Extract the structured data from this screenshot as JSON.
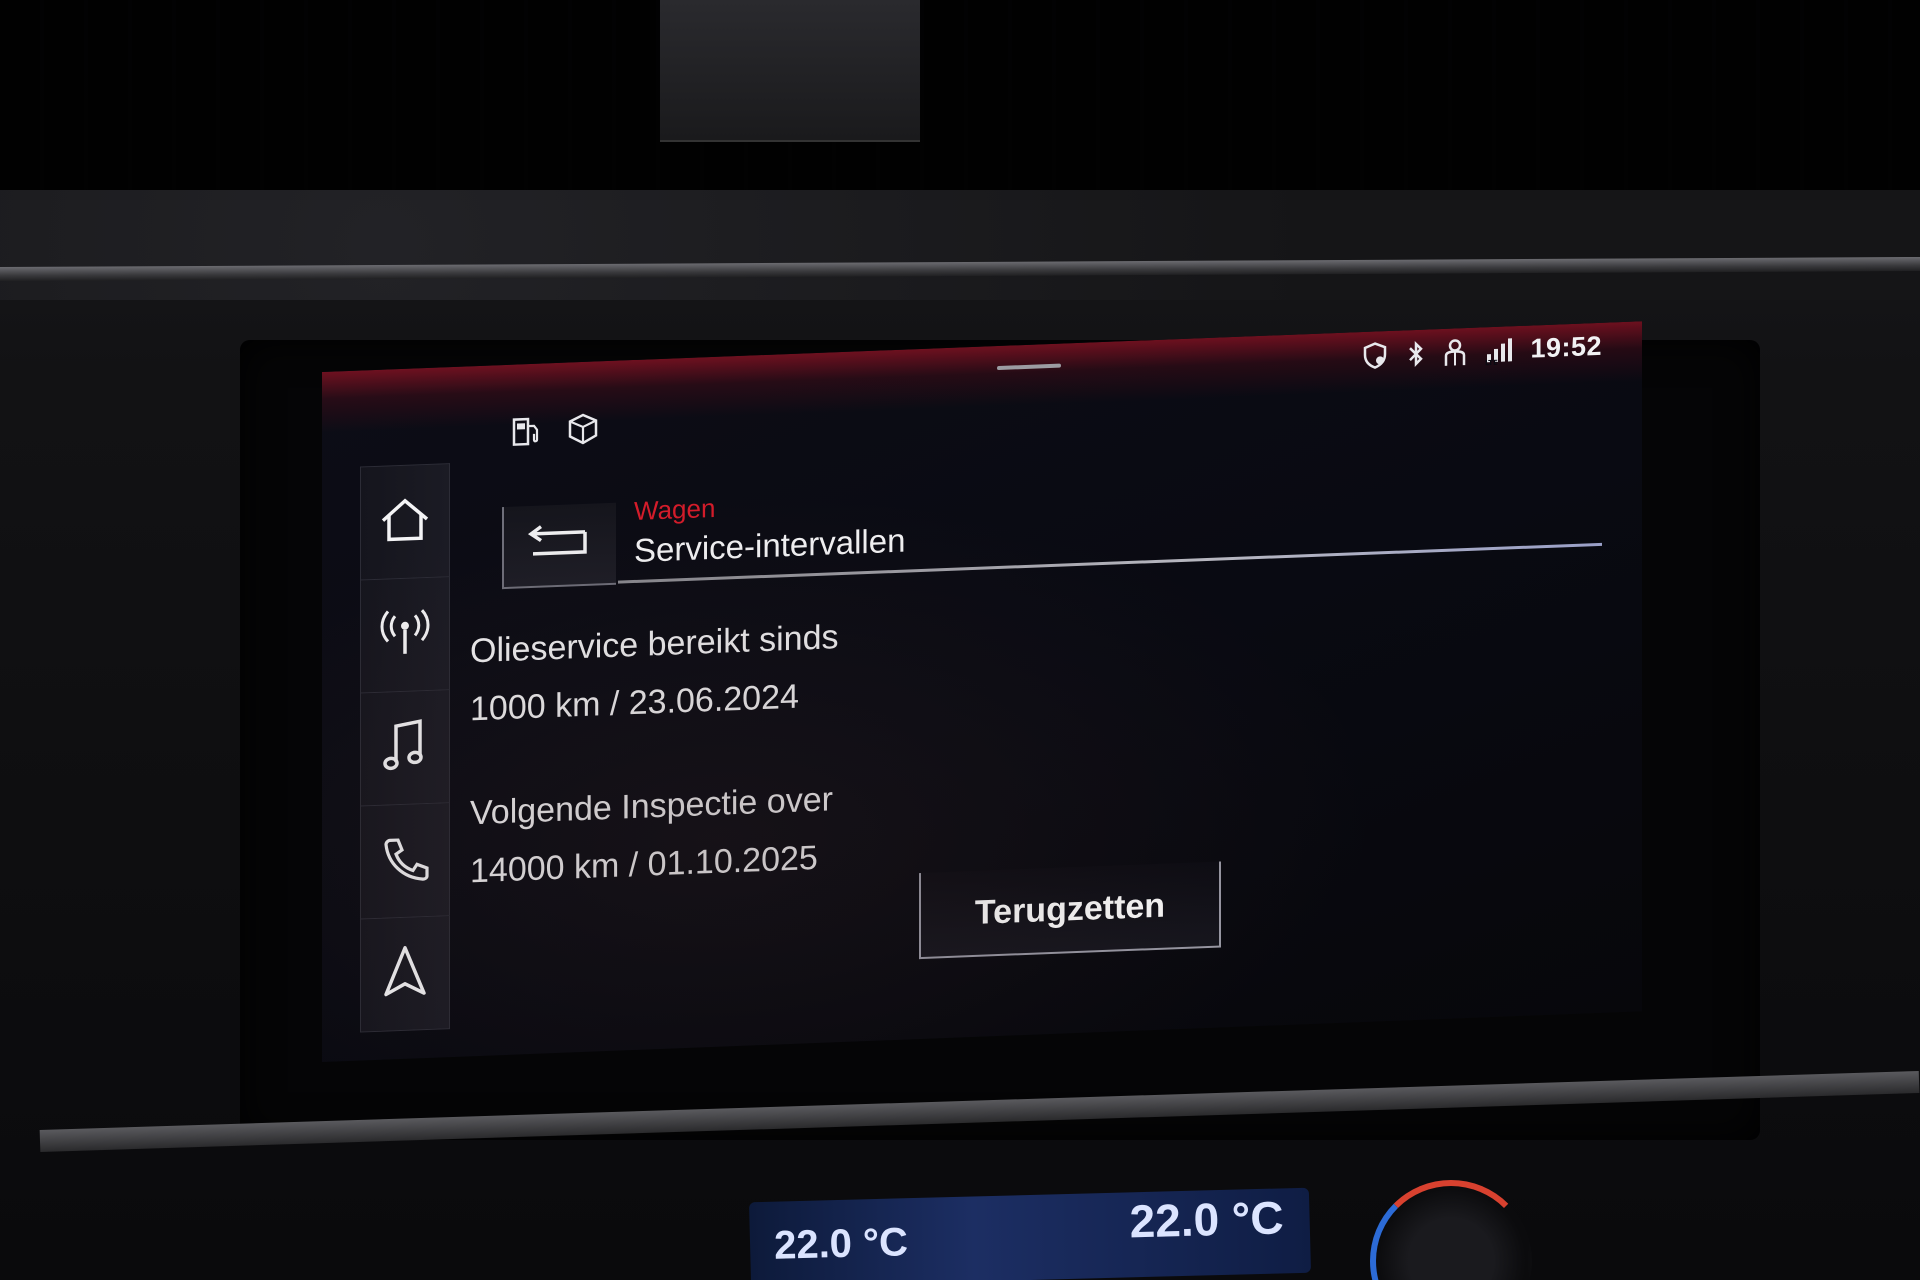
{
  "status_bar": {
    "time": "19:52",
    "icons": [
      "shield-location-icon",
      "bluetooth-icon",
      "user-profile-icon",
      "lte-signal-icon"
    ]
  },
  "top_left_icons": [
    "fuel-charging-icon",
    "package-box-icon"
  ],
  "sidebar": {
    "items": [
      {
        "icon": "home-icon"
      },
      {
        "icon": "radio-antenna-icon"
      },
      {
        "icon": "music-note-icon"
      },
      {
        "icon": "phone-icon"
      },
      {
        "icon": "navigation-arrow-icon"
      }
    ]
  },
  "header": {
    "breadcrumb": "Wagen",
    "title": "Service-intervallen",
    "back_icon": "back-arrow-icon"
  },
  "main": {
    "oil_service_label": "Olieservice bereikt sinds",
    "oil_service_value": "1000 km / 23.06.2024",
    "inspection_label": "Volgende Inspectie over",
    "inspection_value": "14000 km / 01.10.2025",
    "reset_button": "Terugzetten"
  },
  "climate": {
    "left_temp": "22.0 °C",
    "right_temp": "22.0 °C"
  },
  "colors": {
    "accent_red": "#d41c2a",
    "screen_bg": "#0a0a12",
    "text": "#f2f2f4"
  }
}
